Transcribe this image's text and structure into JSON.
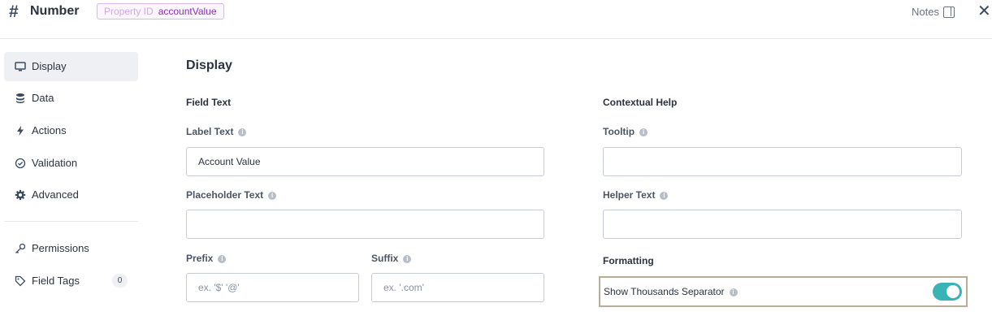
{
  "header": {
    "icon": "hash-icon",
    "title": "Number",
    "property_id_label": "Property ID",
    "property_id_value": "accountValue",
    "notes_label": "Notes"
  },
  "sidebar": {
    "items": [
      {
        "label": "Display",
        "icon": "monitor-icon",
        "active": true
      },
      {
        "label": "Data",
        "icon": "database-icon"
      },
      {
        "label": "Actions",
        "icon": "lightning-icon"
      },
      {
        "label": "Validation",
        "icon": "check-circle-icon"
      },
      {
        "label": "Advanced",
        "icon": "gear-icon"
      },
      {
        "label": "Permissions",
        "icon": "key-icon"
      },
      {
        "label": "Field Tags",
        "icon": "tag-icon",
        "badge": "0"
      }
    ]
  },
  "main": {
    "title": "Display",
    "field_text": {
      "heading": "Field Text",
      "label_text_label": "Label Text",
      "label_text_value": "Account Value",
      "placeholder_text_label": "Placeholder Text",
      "placeholder_text_value": "",
      "prefix_label": "Prefix",
      "prefix_placeholder": "ex. '$' '@'",
      "suffix_label": "Suffix",
      "suffix_placeholder": "ex. '.com'"
    },
    "contextual_help": {
      "heading": "Contextual Help",
      "tooltip_label": "Tooltip",
      "tooltip_value": "",
      "helper_text_label": "Helper Text",
      "helper_text_value": ""
    },
    "formatting": {
      "heading": "Formatting",
      "thousands_separator_label": "Show Thousands Separator",
      "thousands_separator_on": true
    }
  },
  "colors": {
    "accent_toggle": "#3ab3b5",
    "property_id_text": "#8b2fb8",
    "active_nav_bg": "#eef0f4"
  }
}
